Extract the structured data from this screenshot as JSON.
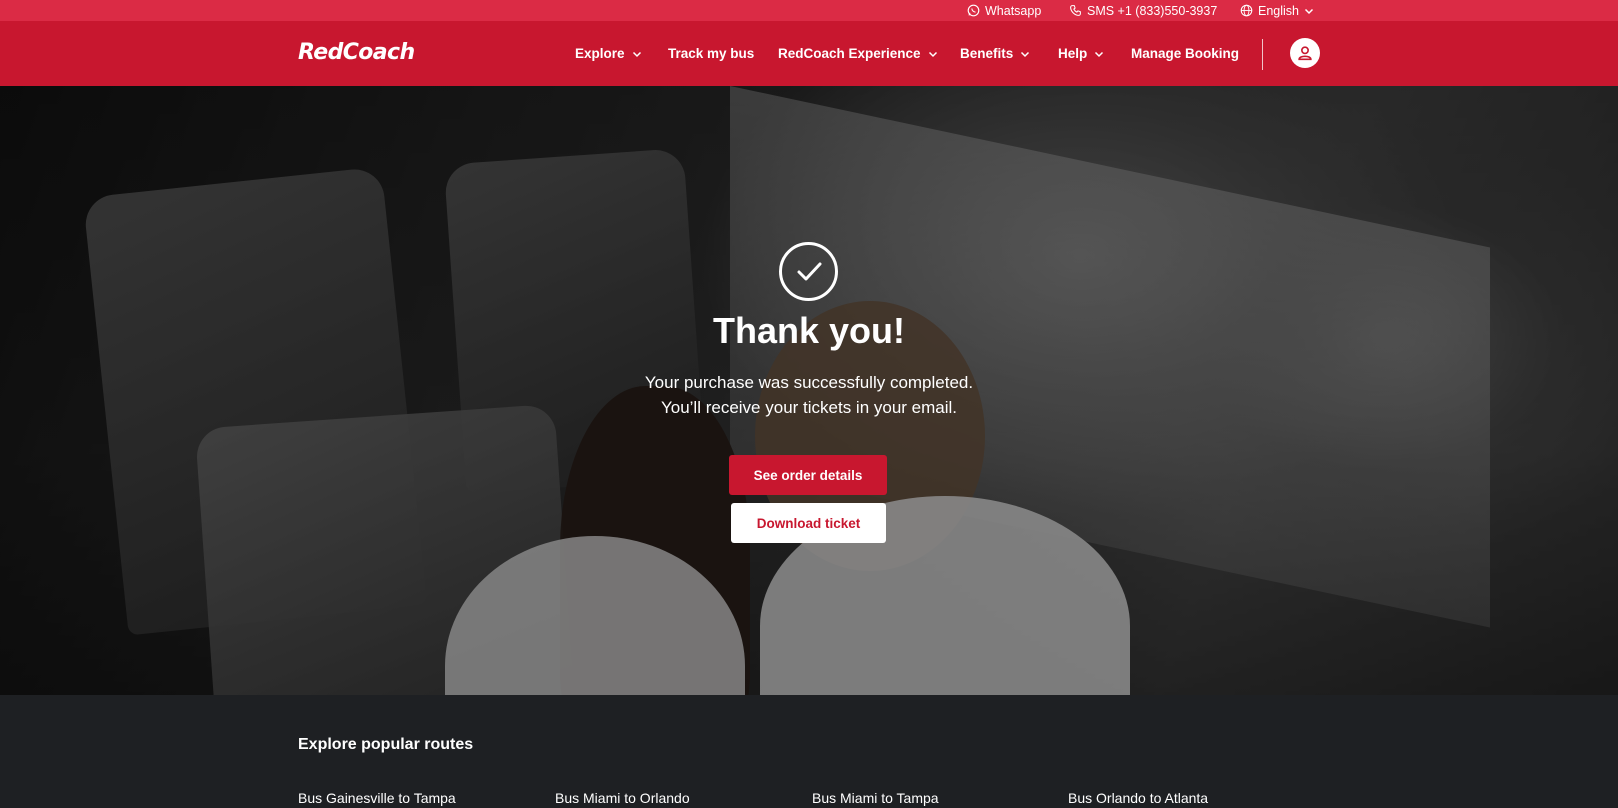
{
  "topbar": {
    "whatsapp_label": "Whatsapp",
    "sms_label": "SMS +1 (833)550-3937",
    "language_label": "English"
  },
  "navbar": {
    "logo_text": "RedCoach",
    "items": [
      {
        "label": "Explore",
        "has_dropdown": true
      },
      {
        "label": "Track my bus",
        "has_dropdown": false
      },
      {
        "label": "RedCoach Experience",
        "has_dropdown": true
      },
      {
        "label": "Benefits",
        "has_dropdown": true
      },
      {
        "label": "Help",
        "has_dropdown": true
      },
      {
        "label": "Manage Booking",
        "has_dropdown": false
      }
    ],
    "profile_icon": "user-icon"
  },
  "hero": {
    "icon": "checkmark-circle-icon",
    "title": "Thank you!",
    "line1": "Your purchase was successfully completed.",
    "line2": "You’ll receive your tickets in your email.",
    "primary_button": "See order details",
    "secondary_button": "Download ticket"
  },
  "footer": {
    "heading": "Explore popular routes",
    "routes": [
      "Bus Gainesville to Tampa",
      "Bus Miami to Orlando",
      "Bus Miami to Tampa",
      "Bus Orlando to Atlanta"
    ]
  },
  "colors": {
    "brand_red": "#c8172f",
    "topbar_red": "#db2b45",
    "footer_bg": "#1e2023"
  }
}
